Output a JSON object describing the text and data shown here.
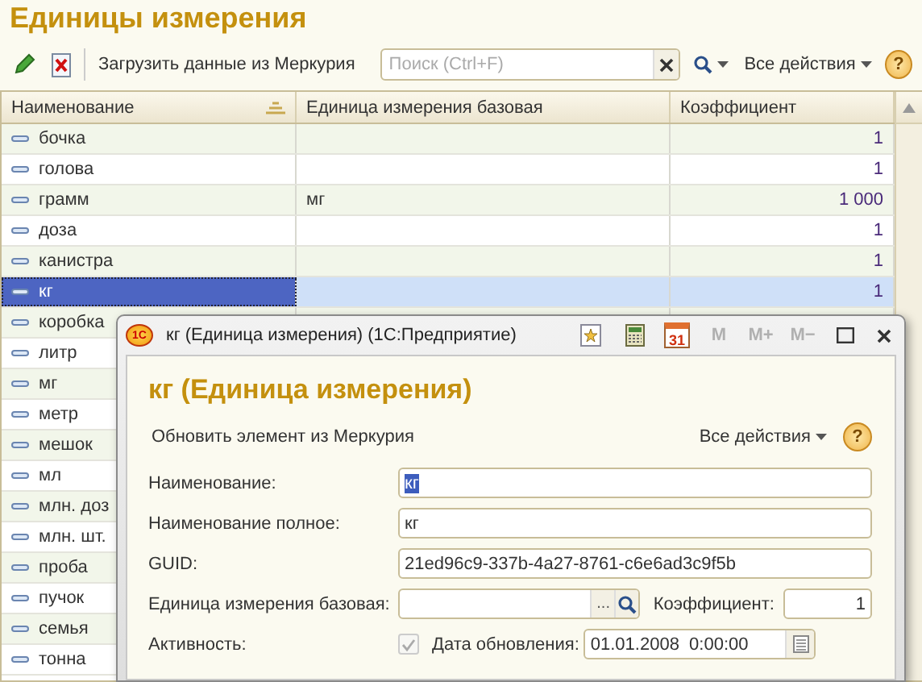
{
  "title": "Единицы измерения",
  "toolbar": {
    "load_button": "Загрузить данные из Меркурия",
    "search": {
      "placeholder": "Поиск (Ctrl+F)"
    },
    "all_actions": "Все действия",
    "help_button": "?"
  },
  "table": {
    "columns": [
      "Наименование",
      "Единица измерения базовая",
      "Коэффициент"
    ],
    "rows": [
      {
        "name": "бочка",
        "coefficient": "1",
        "selected": false
      },
      {
        "name": "голова",
        "coefficient": "1",
        "selected": false
      },
      {
        "name": "грамм",
        "base": "мг",
        "coefficient": "1 000",
        "selected": false
      },
      {
        "name": "доза",
        "coefficient": "1",
        "selected": false
      },
      {
        "name": "канистра",
        "coefficient": "1",
        "selected": false
      },
      {
        "name": "кг",
        "coefficient": "1",
        "selected": true
      },
      {
        "name": "коробка",
        "selected": false
      },
      {
        "name": "литр",
        "selected": false
      },
      {
        "name": "мг",
        "selected": false
      },
      {
        "name": "метр",
        "selected": false
      },
      {
        "name": "мешок",
        "selected": false
      },
      {
        "name": "мл",
        "selected": false
      },
      {
        "name": "млн. доз",
        "selected": false
      },
      {
        "name": "млн. шт.",
        "selected": false
      },
      {
        "name": "проба",
        "selected": false
      },
      {
        "name": "пучок",
        "selected": false
      },
      {
        "name": "семья",
        "selected": false
      },
      {
        "name": "тонна",
        "selected": false
      }
    ]
  },
  "dialog": {
    "window_title": "кг (Единица измерения)  (1С:Предприятие)",
    "logo": "1С",
    "calendar_day": "31",
    "memory_buttons": [
      "M",
      "M+",
      "M−"
    ],
    "heading": "кг (Единица измерения)",
    "update_button": "Обновить элемент из Меркурия",
    "all_actions": "Все действия",
    "help_button": "?",
    "name": {
      "label": "Наименование:",
      "value": "кг"
    },
    "full_name": {
      "label": "Наименование полное:",
      "value": "кг"
    },
    "guid": {
      "label": "GUID:",
      "value": "21ed96c9-337b-4a27-8761-c6e6ad3c9f5b"
    },
    "base_unit": {
      "label": "Единица измерения базовая:",
      "choose_button": "..."
    },
    "coefficient": {
      "label": "Коэффициент:",
      "value": "1"
    },
    "activity": {
      "label": "Активность:",
      "checked": true
    },
    "update_date": {
      "label": "Дата обновления:",
      "value": "01.01.2008  0:00:00"
    }
  }
}
